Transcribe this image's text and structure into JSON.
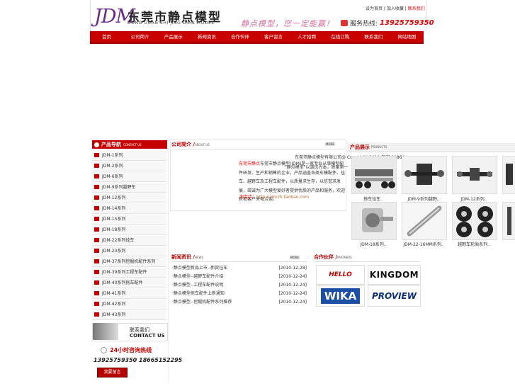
{
  "header": {
    "logo_mark": "JDM",
    "logo_cn": "东莞市静点模型",
    "logo_en": "DONG GUAN SHI JING DIAN MODEL",
    "slogan": "静点模型，您一定能赢！",
    "toplinks": [
      "设为首页",
      "加入收藏",
      "联系我们"
    ],
    "hotline_label": "服务热线:",
    "hotline_number": "13925759350"
  },
  "nav": [
    "首页",
    "公司简介",
    "产品展示",
    "新闻资讯",
    "合作伙伴",
    "客户留言",
    "人才招聘",
    "在线订购",
    "联系我们",
    "网站地图"
  ],
  "sidebar": {
    "title": "产品导航",
    "title_en": "CONTACT US",
    "items": [
      "JDM-1系列",
      "JDM-2系列",
      "JDM-6系列",
      "JDM-9系列越野车",
      "JDM-12系列",
      "JDM-14系列",
      "JDM-15系列",
      "JDM-18系列",
      "JDM-22系列挂车",
      "JDM-23系列",
      "JDM-37系列挖掘机配件系列",
      "JDM-39系列工程车配件",
      "JDM-40系列拖车配件",
      "JDM-41系列",
      "JDM-42系列",
      "JDM-43系列"
    ],
    "contact_cn": "联系我们",
    "contact_en": "CONTACT US",
    "hotline_title": "24小时咨询热线",
    "hotline_numbers": "13925759350  18665152295",
    "message_button": "我要留言"
  },
  "about": {
    "title": "公司简介",
    "title_en": "ABOUT US",
    "more": "MORE",
    "company_name": "东莞市静点",
    "body": "东莞市静点模型(JDM)是一家专业从事模型配件研发、生产和销售的企业，产品涵盖各类车模配件、挂车、越野车及工程车配件，以质量求生存，以信誉求发展，竭诚为广大模型爱好者提供优质的产品和服务，欢迎新老客户来电洽谈。",
    "shop_label": "淘宝店：",
    "shop_url": "http://jdmzh.taobao.com",
    "overlap_copy": "东莞市静点模型有限公司@ Copyright 2018 备案 11860",
    "overlap_line": "\"静点模型\"以诚信为本，质量第一"
  },
  "news": {
    "title": "新闻资讯",
    "title_en": "NEWS",
    "more": "MORE",
    "items": [
      {
        "title": "·静点模型新品上市--新款挂车",
        "date": "[2010-12-28]"
      },
      {
        "title": "·静点模型--越野车配件介绍",
        "date": "[2010-12-24]"
      },
      {
        "title": "·静点模型--工程车配件说明",
        "date": "[2010-12-24]"
      },
      {
        "title": "·静点模型拖车配件上新通知",
        "date": "[2010-12-24]"
      },
      {
        "title": "·静点模型--挖掘机配件系列推荐",
        "date": "[2010-12-24]"
      }
    ]
  },
  "partners": {
    "title": "合作伙伴",
    "title_en": "PARTNERS",
    "logos": [
      "HELLO",
      "KINGDOM",
      "WIKA",
      "PROVIEW"
    ]
  },
  "products": {
    "title": "产品展示",
    "title_en": "PRODUCTS",
    "items": [
      {
        "caption": "拖车挂车.."
      },
      {
        "caption": "JDM-9系列越野.."
      },
      {
        "caption": "JDM-12系列.."
      },
      {
        "caption": "JDM-18系列.."
      },
      {
        "caption": "JDM-22-16MM系列.."
      },
      {
        "caption": "越野车轮胎系列.."
      }
    ]
  }
}
